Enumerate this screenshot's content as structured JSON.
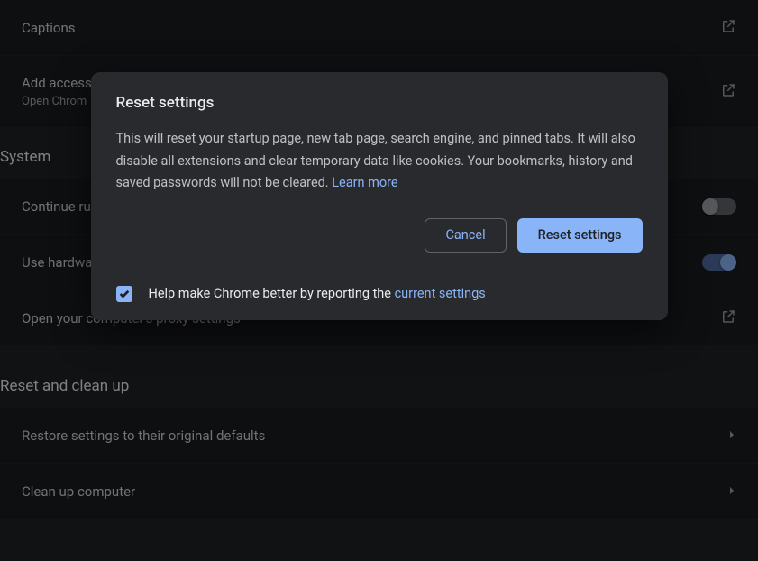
{
  "accessibility": {
    "captions_label": "Captions",
    "add_features_label": "Add access",
    "add_features_sub": "Open Chrom"
  },
  "system": {
    "section_title": "System",
    "continue_running_label": "Continue ru",
    "continue_running_on": false,
    "hardware_accel_label": "Use hardwa",
    "hardware_accel_on": true,
    "proxy_label": "Open your computer's proxy settings"
  },
  "reset_cleanup": {
    "section_title": "Reset and clean up",
    "restore_defaults_label": "Restore settings to their original defaults",
    "cleanup_label": "Clean up computer"
  },
  "dialog": {
    "title": "Reset settings",
    "body_text": "This will reset your startup page, new tab page, search engine, and pinned tabs. It will also disable all extensions and clear temporary data like cookies. Your bookmarks, history and saved passwords will not be cleared. ",
    "learn_more_label": "Learn more",
    "cancel_label": "Cancel",
    "confirm_label": "Reset settings",
    "report_checked": true,
    "report_prefix": "Help make Chrome better by reporting the ",
    "report_link": "current settings"
  }
}
